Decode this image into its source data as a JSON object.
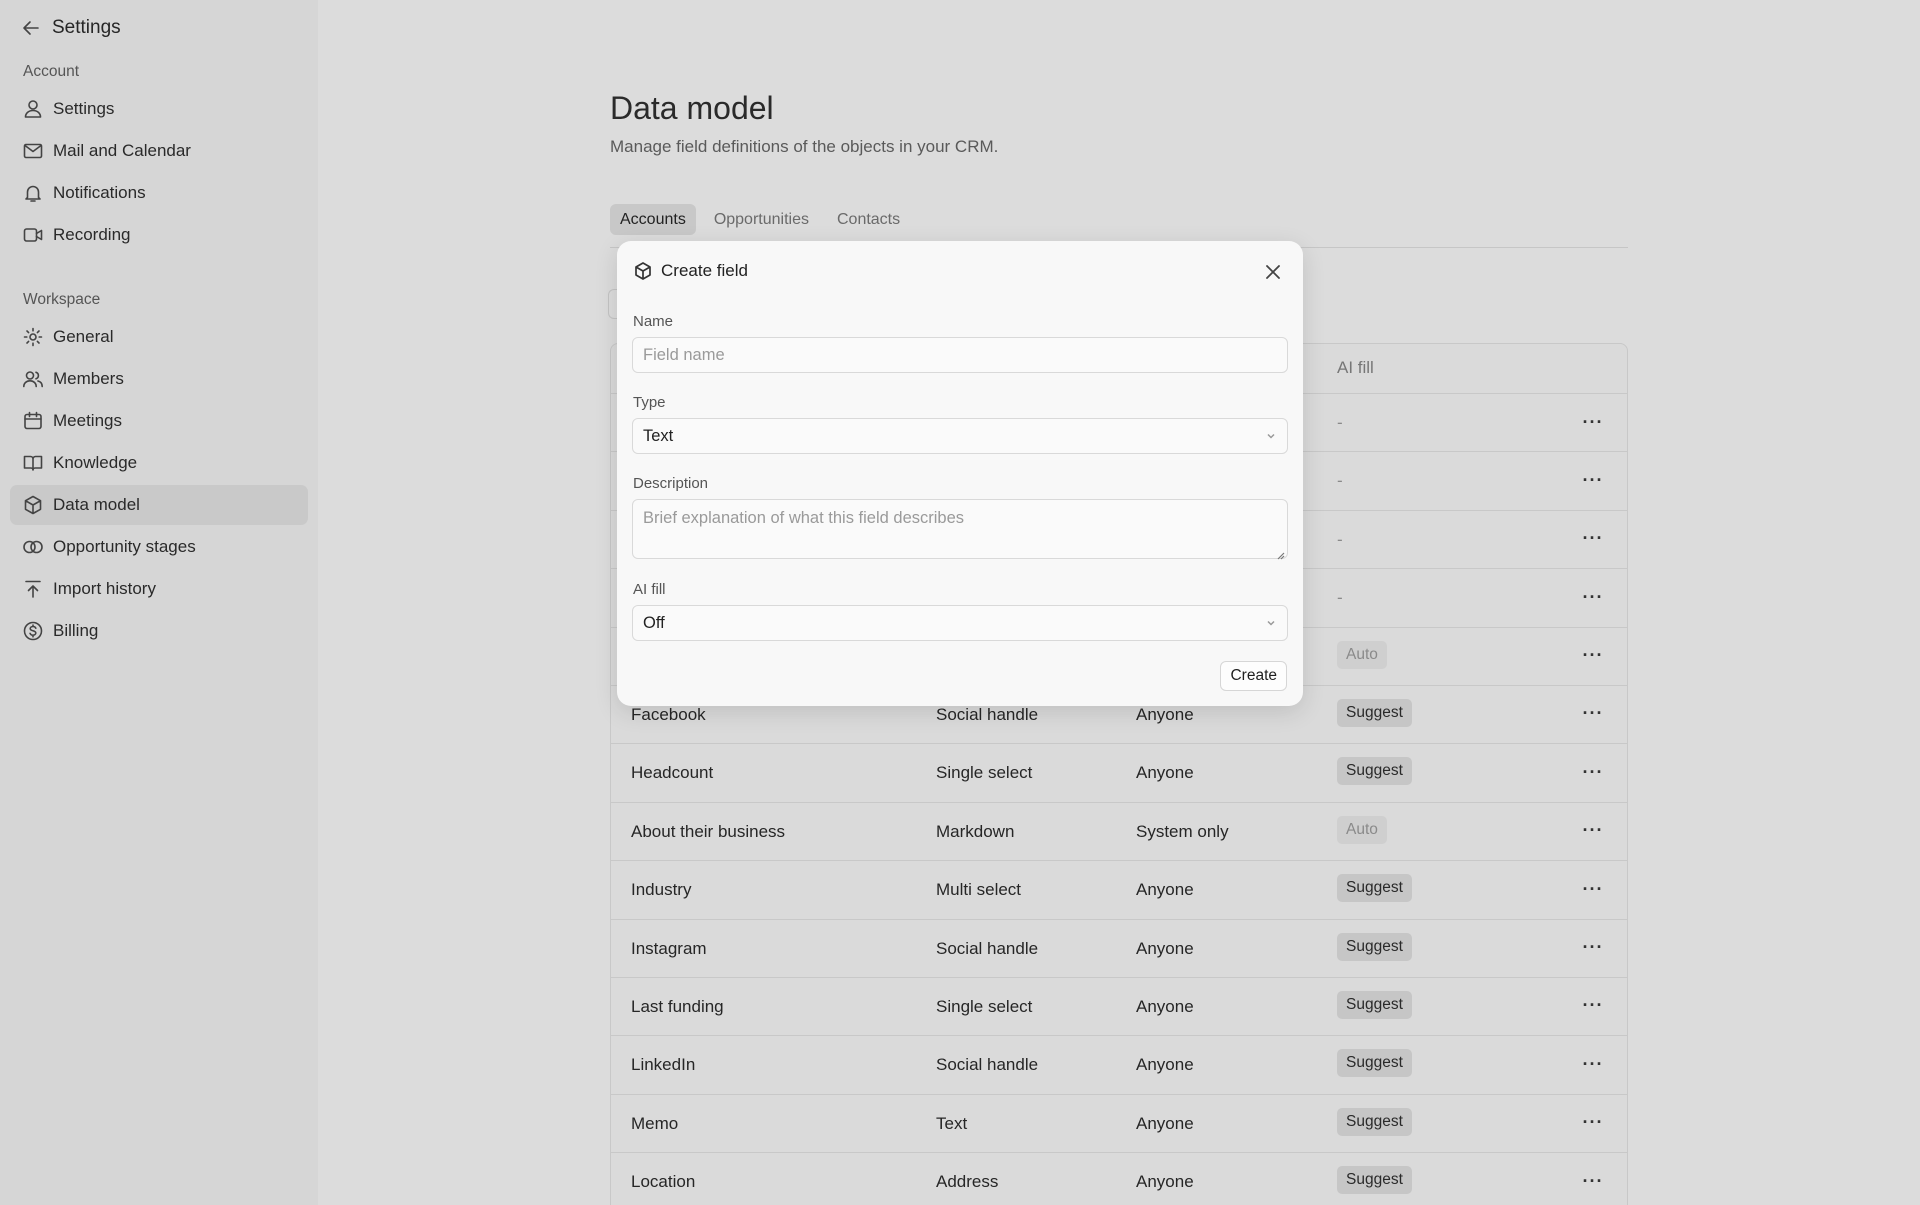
{
  "sidebar": {
    "title": "Settings",
    "account_label": "Account",
    "account_items": [
      {
        "label": "Settings",
        "icon": "user-icon"
      },
      {
        "label": "Mail and Calendar",
        "icon": "mail-icon"
      },
      {
        "label": "Notifications",
        "icon": "bell-icon"
      },
      {
        "label": "Recording",
        "icon": "video-icon"
      }
    ],
    "workspace_label": "Workspace",
    "workspace_items": [
      {
        "label": "General",
        "icon": "gear-icon"
      },
      {
        "label": "Members",
        "icon": "users-icon"
      },
      {
        "label": "Meetings",
        "icon": "calendar-icon"
      },
      {
        "label": "Knowledge",
        "icon": "book-icon"
      },
      {
        "label": "Data model",
        "icon": "cube-icon",
        "active": true
      },
      {
        "label": "Opportunity stages",
        "icon": "rings-icon"
      },
      {
        "label": "Import history",
        "icon": "upload-icon"
      },
      {
        "label": "Billing",
        "icon": "dollar-icon"
      }
    ]
  },
  "main": {
    "title": "Data model",
    "subtitle": "Manage field definitions of the objects in your CRM.",
    "tabs": [
      "Accounts",
      "Opportunities",
      "Contacts"
    ],
    "active_tab": "Accounts",
    "table": {
      "ai_fill_header": "AI fill",
      "rows": [
        {
          "name": "",
          "type": "",
          "access": "",
          "ai": "-"
        },
        {
          "name": "",
          "type": "",
          "access": "",
          "ai": "-"
        },
        {
          "name": "",
          "type": "",
          "access": "",
          "ai": "-"
        },
        {
          "name": "",
          "type": "",
          "access": "",
          "ai": "-"
        },
        {
          "name": "",
          "type": "",
          "access": "",
          "ai": "Auto"
        },
        {
          "name": "Facebook",
          "type": "Social handle",
          "access": "Anyone",
          "ai": "Suggest"
        },
        {
          "name": "Headcount",
          "type": "Single select",
          "access": "Anyone",
          "ai": "Suggest"
        },
        {
          "name": "About their business",
          "type": "Markdown",
          "access": "System only",
          "ai": "Auto"
        },
        {
          "name": "Industry",
          "type": "Multi select",
          "access": "Anyone",
          "ai": "Suggest"
        },
        {
          "name": "Instagram",
          "type": "Social handle",
          "access": "Anyone",
          "ai": "Suggest"
        },
        {
          "name": "Last funding",
          "type": "Single select",
          "access": "Anyone",
          "ai": "Suggest"
        },
        {
          "name": "LinkedIn",
          "type": "Social handle",
          "access": "Anyone",
          "ai": "Suggest"
        },
        {
          "name": "Memo",
          "type": "Text",
          "access": "Anyone",
          "ai": "Suggest"
        },
        {
          "name": "Location",
          "type": "Address",
          "access": "Anyone",
          "ai": "Suggest"
        }
      ]
    }
  },
  "modal": {
    "title": "Create field",
    "name_label": "Name",
    "name_placeholder": "Field name",
    "type_label": "Type",
    "type_value": "Text",
    "description_label": "Description",
    "description_placeholder": "Brief explanation of what this field describes",
    "ai_fill_label": "AI fill",
    "ai_fill_value": "Off",
    "create_label": "Create"
  }
}
